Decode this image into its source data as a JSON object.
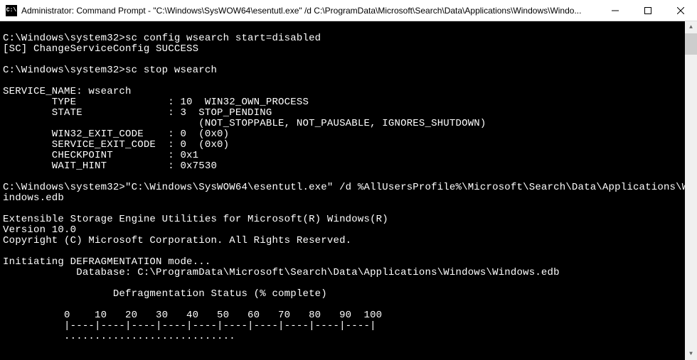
{
  "window": {
    "icon_label": "C:\\",
    "title": "Administrator: Command Prompt - \"C:\\Windows\\SysWOW64\\esentutl.exe\"  /d C:\\ProgramData\\Microsoft\\Search\\Data\\Applications\\Windows\\Windo..."
  },
  "console": {
    "lines": [
      "",
      "C:\\Windows\\system32>sc config wsearch start=disabled",
      "[SC] ChangeServiceConfig SUCCESS",
      "",
      "C:\\Windows\\system32>sc stop wsearch",
      "",
      "SERVICE_NAME: wsearch",
      "        TYPE               : 10  WIN32_OWN_PROCESS",
      "        STATE              : 3  STOP_PENDING",
      "                                (NOT_STOPPABLE, NOT_PAUSABLE, IGNORES_SHUTDOWN)",
      "        WIN32_EXIT_CODE    : 0  (0x0)",
      "        SERVICE_EXIT_CODE  : 0  (0x0)",
      "        CHECKPOINT         : 0x1",
      "        WAIT_HINT          : 0x7530",
      "",
      "C:\\Windows\\system32>\"C:\\Windows\\SysWOW64\\esentutl.exe\" /d %AllUsersProfile%\\Microsoft\\Search\\Data\\Applications\\Windows\\W",
      "indows.edb",
      "",
      "Extensible Storage Engine Utilities for Microsoft(R) Windows(R)",
      "Version 10.0",
      "Copyright (C) Microsoft Corporation. All Rights Reserved.",
      "",
      "Initiating DEFRAGMENTATION mode...",
      "            Database: C:\\ProgramData\\Microsoft\\Search\\Data\\Applications\\Windows\\Windows.edb",
      "",
      "                  Defragmentation Status (% complete)",
      "",
      "          0    10   20   30   40   50   60   70   80   90  100",
      "          |----|----|----|----|----|----|----|----|----|----|",
      "          ............................"
    ]
  },
  "scrollbar": {
    "up": "▲",
    "down": "▼"
  }
}
